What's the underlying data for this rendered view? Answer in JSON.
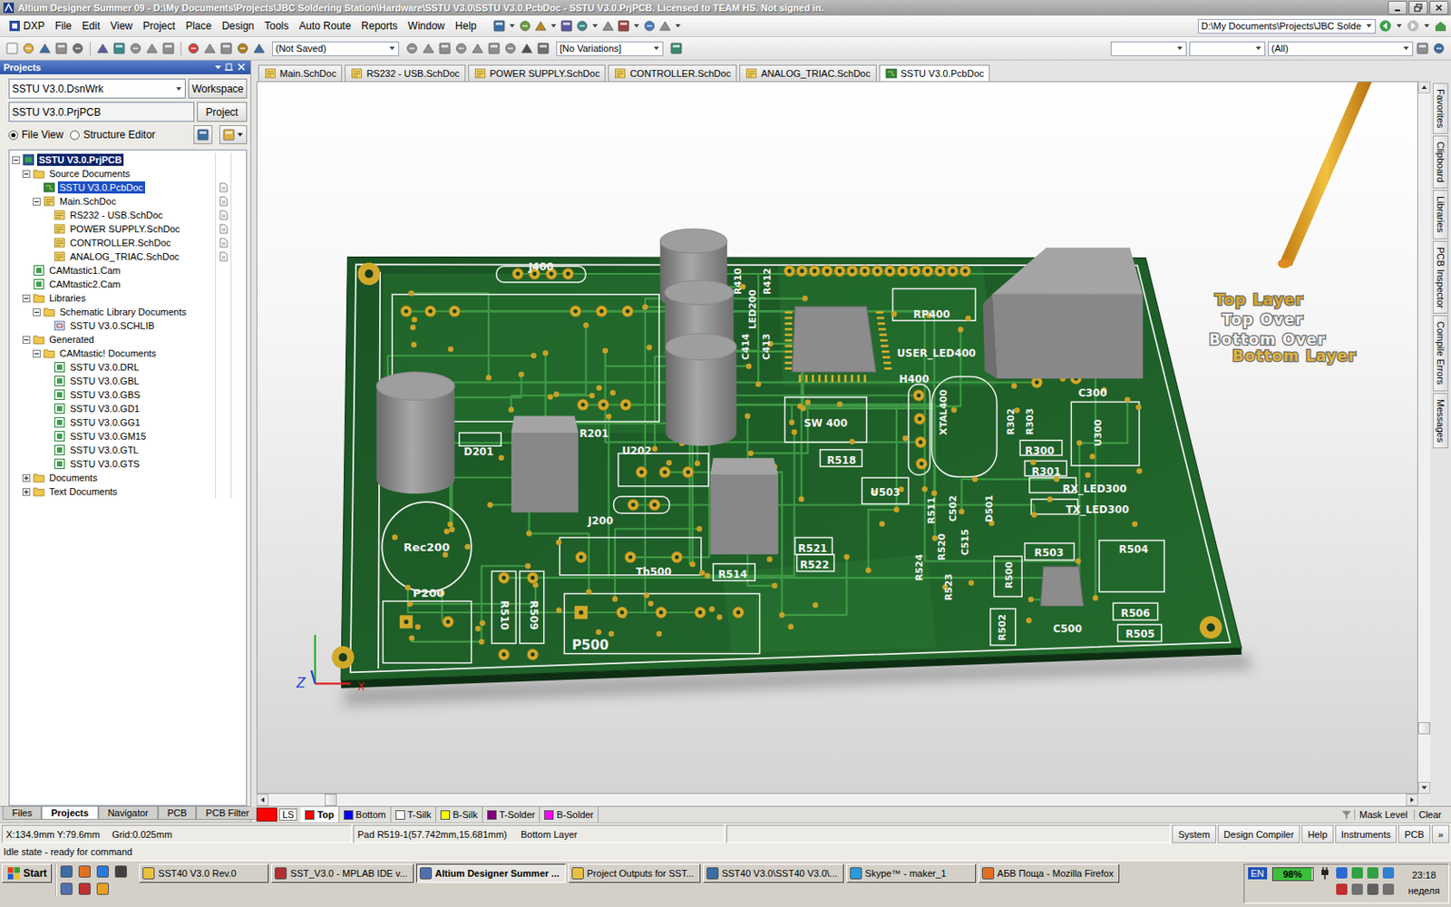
{
  "window": {
    "title": "Altium Designer Summer 09 - D:\\My Documents\\Projects\\JBC Soldering Station\\Hardware\\SSTU V3.0\\SSTU V3.0.PcbDoc - SSTU V3.0.PrjPCB. Licensed to TEAM HS. Not signed in."
  },
  "menu": [
    "DXP",
    "File",
    "Edit",
    "View",
    "Project",
    "Place",
    "Design",
    "Tools",
    "Auto Route",
    "Reports",
    "Window",
    "Help"
  ],
  "path_field": {
    "value": "D:\\My Documents\\Projects\\JBC Solde"
  },
  "toolbar": {
    "dropdowns": [
      "(Not Saved)",
      "[No Variations]"
    ],
    "filters": [
      "",
      "",
      "(All)"
    ]
  },
  "projects_panel": {
    "title": "Projects",
    "workspace": {
      "value": "SSTU V3.0.DsnWrk",
      "button": "Workspace"
    },
    "project": {
      "value": "SSTU V3.0.PrjPCB",
      "button": "Project"
    },
    "views": [
      {
        "label": "File View",
        "selected": true
      },
      {
        "label": "Structure Editor",
        "selected": false
      }
    ],
    "tree": [
      {
        "label": "SSTU V3.0.PrjPCB",
        "level": 0,
        "kind": "project",
        "expandable": true,
        "expanded": true,
        "selected": false,
        "bold": true,
        "doc_icon": false
      },
      {
        "label": "Source Documents",
        "level": 1,
        "kind": "folder",
        "expandable": true,
        "expanded": true,
        "selected": false,
        "bold": false,
        "doc_icon": false
      },
      {
        "label": "SSTU V3.0.PcbDoc",
        "level": 2,
        "kind": "pcb",
        "expandable": false,
        "expanded": false,
        "selected": true,
        "bold": false,
        "doc_icon": true
      },
      {
        "label": "Main.SchDoc",
        "level": 2,
        "kind": "sch",
        "expandable": true,
        "expanded": true,
        "selected": false,
        "bold": false,
        "doc_icon": true
      },
      {
        "label": "RS232 - USB.SchDoc",
        "level": 3,
        "kind": "sch",
        "expandable": false,
        "expanded": false,
        "selected": false,
        "bold": false,
        "doc_icon": true
      },
      {
        "label": "POWER SUPPLY.SchDoc",
        "level": 3,
        "kind": "sch",
        "expandable": false,
        "expanded": false,
        "selected": false,
        "bold": false,
        "doc_icon": true
      },
      {
        "label": "CONTROLLER.SchDoc",
        "level": 3,
        "kind": "sch",
        "expandable": false,
        "expanded": false,
        "selected": false,
        "bold": false,
        "doc_icon": true
      },
      {
        "label": "ANALOG_TRIAC.SchDoc",
        "level": 3,
        "kind": "sch",
        "expandable": false,
        "expanded": false,
        "selected": false,
        "bold": false,
        "doc_icon": true
      },
      {
        "label": "CAMtastic1.Cam",
        "level": 1,
        "kind": "cam",
        "expandable": false,
        "expanded": false,
        "selected": false,
        "bold": false,
        "doc_icon": false
      },
      {
        "label": "CAMtastic2.Cam",
        "level": 1,
        "kind": "cam",
        "expandable": false,
        "expanded": false,
        "selected": false,
        "bold": false,
        "doc_icon": false
      },
      {
        "label": "Libraries",
        "level": 1,
        "kind": "folder",
        "expandable": true,
        "expanded": true,
        "selected": false,
        "bold": false,
        "doc_icon": false
      },
      {
        "label": "Schematic Library Documents",
        "level": 2,
        "kind": "folder",
        "expandable": true,
        "expanded": true,
        "selected": false,
        "bold": false,
        "doc_icon": false
      },
      {
        "label": "SSTU V3.0.SCHLIB",
        "level": 3,
        "kind": "lib",
        "expandable": false,
        "expanded": false,
        "selected": false,
        "bold": false,
        "doc_icon": false
      },
      {
        "label": "Generated",
        "level": 1,
        "kind": "folder",
        "expandable": true,
        "expanded": true,
        "selected": false,
        "bold": false,
        "doc_icon": false
      },
      {
        "label": "CAMtastic! Documents",
        "level": 2,
        "kind": "folder",
        "expandable": true,
        "expanded": true,
        "selected": false,
        "bold": false,
        "doc_icon": false
      },
      {
        "label": "SSTU V3.0.DRL",
        "level": 3,
        "kind": "cam",
        "expandable": false,
        "expanded": false,
        "selected": false,
        "bold": false,
        "doc_icon": false
      },
      {
        "label": "SSTU V3.0.GBL",
        "level": 3,
        "kind": "cam",
        "expandable": false,
        "expanded": false,
        "selected": false,
        "bold": false,
        "doc_icon": false
      },
      {
        "label": "SSTU V3.0.GBS",
        "level": 3,
        "kind": "cam",
        "expandable": false,
        "expanded": false,
        "selected": false,
        "bold": false,
        "doc_icon": false
      },
      {
        "label": "SSTU V3.0.GD1",
        "level": 3,
        "kind": "cam",
        "expandable": false,
        "expanded": false,
        "selected": false,
        "bold": false,
        "doc_icon": false
      },
      {
        "label": "SSTU V3.0.GG1",
        "level": 3,
        "kind": "cam",
        "expandable": false,
        "expanded": false,
        "selected": false,
        "bold": false,
        "doc_icon": false
      },
      {
        "label": "SSTU V3.0.GM15",
        "level": 3,
        "kind": "cam",
        "expandable": false,
        "expanded": false,
        "selected": false,
        "bold": false,
        "doc_icon": false
      },
      {
        "label": "SSTU V3.0.GTL",
        "level": 3,
        "kind": "cam",
        "expandable": false,
        "expanded": false,
        "selected": false,
        "bold": false,
        "doc_icon": false
      },
      {
        "label": "SSTU V3.0.GTS",
        "level": 3,
        "kind": "cam",
        "expandable": false,
        "expanded": false,
        "selected": false,
        "bold": false,
        "doc_icon": false
      },
      {
        "label": "Documents",
        "level": 1,
        "kind": "folder",
        "expandable": true,
        "expanded": false,
        "selected": false,
        "bold": false,
        "doc_icon": false
      },
      {
        "label": "Text Documents",
        "level": 1,
        "kind": "folder",
        "expandable": true,
        "expanded": false,
        "selected": false,
        "bold": false,
        "doc_icon": false
      }
    ],
    "tabs": [
      {
        "label": "Files",
        "selected": false
      },
      {
        "label": "Projects",
        "selected": true
      },
      {
        "label": "Navigator",
        "selected": false
      },
      {
        "label": "PCB",
        "selected": false
      },
      {
        "label": "PCB Filter",
        "selected": false
      }
    ]
  },
  "document_tabs": [
    {
      "label": "Main.SchDoc",
      "kind": "sch",
      "selected": false
    },
    {
      "label": "RS232 - USB.SchDoc",
      "kind": "sch",
      "selected": false
    },
    {
      "label": "POWER SUPPLY.SchDoc",
      "kind": "sch",
      "selected": false
    },
    {
      "label": "CONTROLLER.SchDoc",
      "kind": "sch",
      "selected": false
    },
    {
      "label": "ANALOG_TRIAC.SchDoc",
      "kind": "sch",
      "selected": false
    },
    {
      "label": "SSTU V3.0.PcbDoc",
      "kind": "pcb",
      "selected": true
    }
  ],
  "pcb_view": {
    "labels": [
      "J400",
      "R410",
      "R412",
      "LED200",
      "RP400",
      "USER_LED400",
      "H400",
      "XTAL400",
      "C414",
      "C413",
      "SW 400",
      "R518",
      "D201",
      "R201",
      "U202",
      "J200",
      "U503",
      "R511",
      "C502",
      "D501",
      "R521",
      "R522",
      "R514",
      "Th500",
      "Rec200",
      "P200",
      "R510",
      "R509",
      "P500",
      "R524",
      "R520",
      "C515",
      "R523",
      "R500",
      "R502",
      "R503",
      "C500",
      "R504",
      "R506",
      "R505",
      "C300",
      "R302",
      "R303",
      "R300",
      "R301",
      "U300",
      "RX_LED300",
      "TX_LED300"
    ],
    "legend": [
      {
        "text": "Top Layer",
        "color": "#d9a82c"
      },
      {
        "text": "Top Over",
        "color": "#f4f4f4"
      },
      {
        "text": "Bottom Over",
        "color": "#f4f4f4"
      },
      {
        "text": "Bottom Layer",
        "color": "#e0b43a"
      }
    ],
    "axis_labels": [
      "Z",
      "X"
    ],
    "scroll": {
      "vertical": 0.93,
      "horizontal": 0.05
    }
  },
  "side_tabs": [
    "Favorites",
    "Clipboard",
    "Libraries",
    "PCB Inspector",
    "Compile Errors",
    "Messages"
  ],
  "layer_set": {
    "label": "LS",
    "color": "#ff0000"
  },
  "layer_tabs": [
    {
      "label": "Top",
      "color": "#ff0000",
      "selected": true
    },
    {
      "label": "Bottom",
      "color": "#0000ff",
      "selected": false
    },
    {
      "label": "T-Silk",
      "color": "#ffffff",
      "selected": false
    },
    {
      "label": "B-Silk",
      "color": "#ffff00",
      "selected": false
    },
    {
      "label": "T-Solder",
      "color": "#800080",
      "selected": false
    },
    {
      "label": "B-Solder",
      "color": "#ff00ff",
      "selected": false
    }
  ],
  "layer_tools": [
    "Mask Level",
    "Clear"
  ],
  "status_bar": {
    "coords": "X:134.9mm Y:79.6mm",
    "grid": "Grid:0.025mm",
    "pad": "Pad R519-1(57.742mm,15.681mm)",
    "layer": "Bottom Layer",
    "buttons": [
      "System",
      "Design Compiler",
      "Help",
      "Instruments",
      "PCB",
      "»"
    ]
  },
  "status_line": "Idle state - ready for command",
  "taskbar": {
    "start": "Start",
    "tasks": [
      {
        "label": "SST40 V3.0 Rev.0",
        "selected": false
      },
      {
        "label": "SST_V3.0 - MPLAB IDE v...",
        "selected": false
      },
      {
        "label": "Altium Designer Summer ...",
        "selected": true
      },
      {
        "label": "Project Outputs for SST...",
        "selected": false
      },
      {
        "label": "SST40 V3.0\\SST40 V3.0\\...",
        "selected": false
      },
      {
        "label": "Skype™ - maker_1",
        "selected": false
      },
      {
        "label": "АБВ Поща - Mozilla Firefox",
        "selected": false
      }
    ],
    "language": "EN",
    "battery": {
      "reading": "98%",
      "level": 0.98
    },
    "time": "23:18",
    "day": "неделя"
  }
}
